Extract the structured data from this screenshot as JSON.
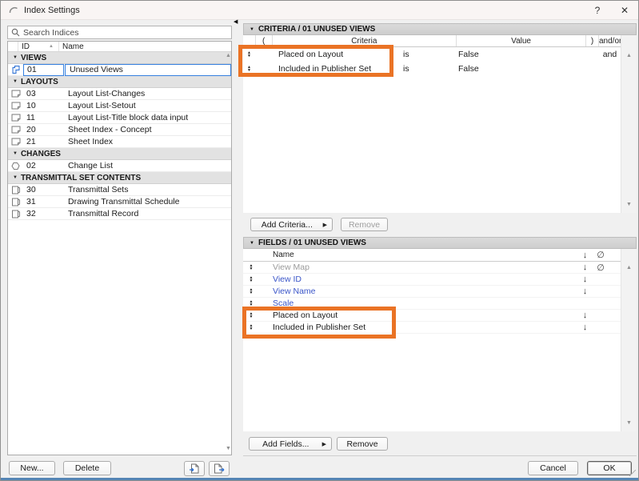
{
  "window": {
    "title": "Index Settings",
    "help": "?",
    "close": "✕"
  },
  "icons": {
    "collapse": "▼",
    "sort_asc": "▲",
    "submenu": "▶",
    "scroll_up": "▲",
    "scroll_down": "▼",
    "splitter_left": "◀",
    "sort_down": "↓",
    "hidden_field": "∅",
    "reorder_up": "▲",
    "reorder_down": "▼"
  },
  "search": {
    "placeholder": "Search Indices"
  },
  "list": {
    "col_id": "ID",
    "col_name": "Name",
    "groups": [
      {
        "label": "VIEWS",
        "rows": [
          {
            "id": "01",
            "name": "Unused Views"
          }
        ]
      },
      {
        "label": "LAYOUTS",
        "rows": [
          {
            "id": "03",
            "name": "Layout List-Changes"
          },
          {
            "id": "10",
            "name": "Layout List-Setout"
          },
          {
            "id": "11",
            "name": "Layout List-Title block data input"
          },
          {
            "id": "20",
            "name": "Sheet Index - Concept"
          },
          {
            "id": "21",
            "name": "Sheet Index"
          }
        ]
      },
      {
        "label": "CHANGES",
        "rows": [
          {
            "id": "02",
            "name": "Change List"
          }
        ]
      },
      {
        "label": "TRANSMITTAL SET CONTENTS",
        "rows": [
          {
            "id": "30",
            "name": "Transmittal Sets"
          },
          {
            "id": "31",
            "name": "Drawing Transmittal Schedule"
          },
          {
            "id": "32",
            "name": "Transmittal Record"
          }
        ]
      }
    ]
  },
  "criteria": {
    "bar": "CRITERIA / 01 UNUSED VIEWS",
    "col_open": "(",
    "col_criteria": "Criteria",
    "col_value": "Value",
    "col_close": ")",
    "col_andor": "and/or",
    "rows": [
      {
        "name": "Placed on Layout",
        "op": "is",
        "value": "False",
        "andor": "and"
      },
      {
        "name": "Included in Publisher Set",
        "op": "is",
        "value": "False",
        "andor": ""
      }
    ],
    "add": "Add Criteria...",
    "remove": "Remove"
  },
  "fields": {
    "bar": "FIELDS / 01 UNUSED VIEWS",
    "col_name": "Name",
    "rows": [
      {
        "name": "View Map"
      },
      {
        "name": "View ID"
      },
      {
        "name": "View Name"
      },
      {
        "name": "Scale"
      },
      {
        "name": "Placed on Layout"
      },
      {
        "name": "Included in Publisher Set"
      }
    ],
    "add": "Add Fields...",
    "remove": "Remove"
  },
  "footer": {
    "new": "New...",
    "delete": "Delete",
    "cancel": "Cancel",
    "ok": "OK"
  },
  "colors": {
    "annotation": "#EA7325",
    "link_text": "#3A55C8",
    "selection_border": "#3580DF"
  }
}
